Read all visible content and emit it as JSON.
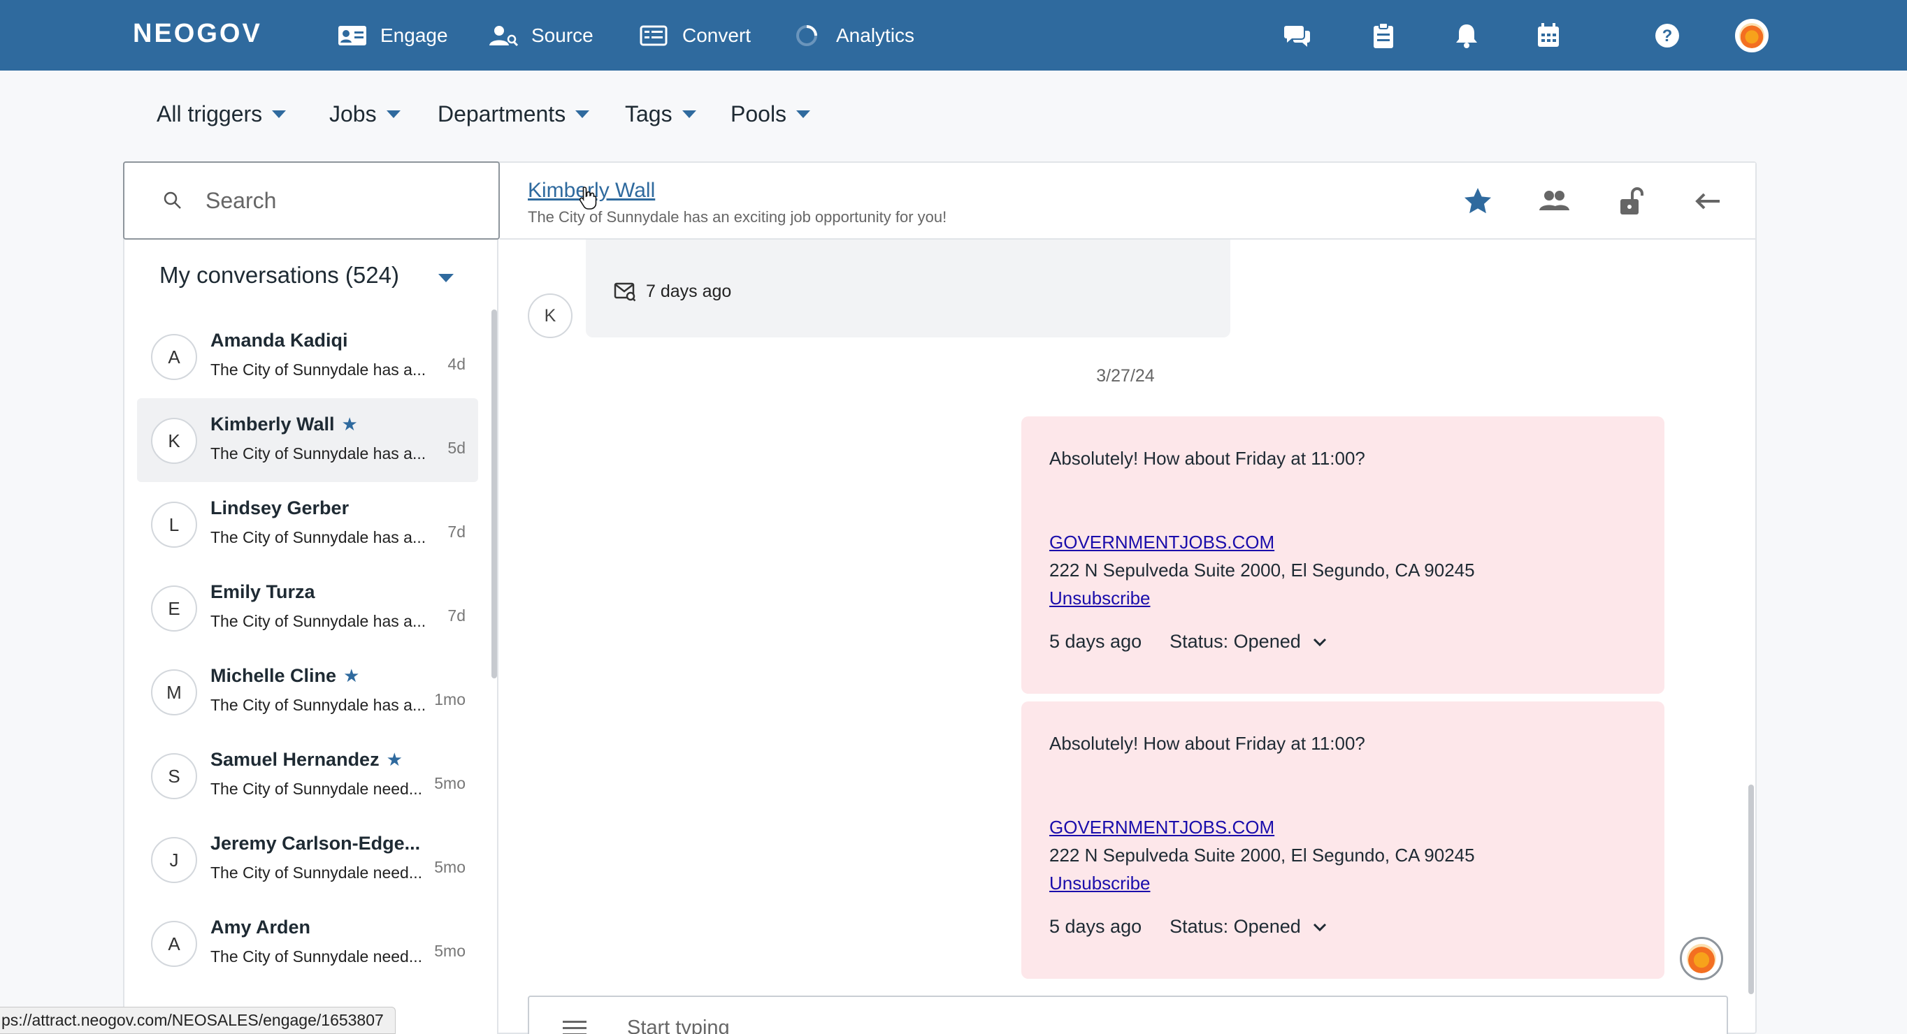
{
  "topnav": {
    "logo": "NEOGOV",
    "items": [
      {
        "label": "Engage",
        "icon": "contact-card-icon"
      },
      {
        "label": "Source",
        "icon": "person-search-icon"
      },
      {
        "label": "Convert",
        "icon": "list-icon"
      },
      {
        "label": "Analytics",
        "icon": "loading-spinner-icon"
      }
    ],
    "right_icons": [
      "chat-bubbles-icon",
      "clipboard-icon",
      "bell-icon",
      "calendar-icon",
      "help-icon"
    ],
    "brand_color": "#2f6a9e"
  },
  "filters": [
    {
      "label": "All triggers"
    },
    {
      "label": "Jobs"
    },
    {
      "label": "Departments"
    },
    {
      "label": "Tags"
    },
    {
      "label": "Pools"
    }
  ],
  "search": {
    "placeholder": "Search"
  },
  "conversations": {
    "header": "My conversations (524)",
    "items": [
      {
        "initial": "A",
        "name": "Amanda Kadiqi",
        "starred": false,
        "preview": "The City of Sunnydale has a...",
        "time": "4d",
        "active": false
      },
      {
        "initial": "K",
        "name": "Kimberly Wall",
        "starred": true,
        "preview": "The City of Sunnydale has a...",
        "time": "5d",
        "active": true
      },
      {
        "initial": "L",
        "name": "Lindsey Gerber",
        "starred": false,
        "preview": "The City of Sunnydale has a...",
        "time": "7d",
        "active": false
      },
      {
        "initial": "E",
        "name": "Emily Turza",
        "starred": false,
        "preview": "The City of Sunnydale has a...",
        "time": "7d",
        "active": false
      },
      {
        "initial": "M",
        "name": "Michelle Cline",
        "starred": true,
        "preview": "The City of Sunnydale has a...",
        "time": "1mo",
        "active": false
      },
      {
        "initial": "S",
        "name": "Samuel Hernandez",
        "starred": true,
        "preview": "The City of Sunnydale need...",
        "time": "5mo",
        "active": false
      },
      {
        "initial": "J",
        "name": "Jeremy Carlson-Edge...",
        "starred": false,
        "preview": "The City of Sunnydale need...",
        "time": "5mo",
        "active": false
      },
      {
        "initial": "A",
        "name": "Amy Arden",
        "starred": false,
        "preview": "The City of Sunnydale need...",
        "time": "5mo",
        "active": false
      }
    ]
  },
  "chat": {
    "contact_name": "Kimberly Wall",
    "contact_subtitle": "The City of Sunnydale has an exciting job opportunity for you!",
    "header_icons": [
      "star-icon",
      "people-icon",
      "unlock-icon",
      "back-arrow-icon"
    ],
    "incoming": {
      "avatar_initial": "K",
      "time": "7 days ago"
    },
    "date_separator": "3/27/24",
    "messages": [
      {
        "text": "Absolutely! How about Friday at 11:00?",
        "link": "GOVERNMENTJOBS.COM",
        "address": "222 N Sepulveda Suite 2000, El Segundo, CA 90245",
        "unsubscribe": "Unsubscribe",
        "time": "5 days ago",
        "status": "Status: Opened"
      },
      {
        "text": "Absolutely! How about Friday at 11:00?",
        "link": "GOVERNMENTJOBS.COM",
        "address": "222 N Sepulveda Suite 2000, El Segundo, CA 90245",
        "unsubscribe": "Unsubscribe",
        "time": "5 days ago",
        "status": "Status: Opened"
      }
    ],
    "composer_placeholder": "Start typing",
    "bubble_color": "#fde7ea"
  },
  "statusbar": {
    "url": "ps://attract.neogov.com/NEOSALES/engage/1653807"
  }
}
